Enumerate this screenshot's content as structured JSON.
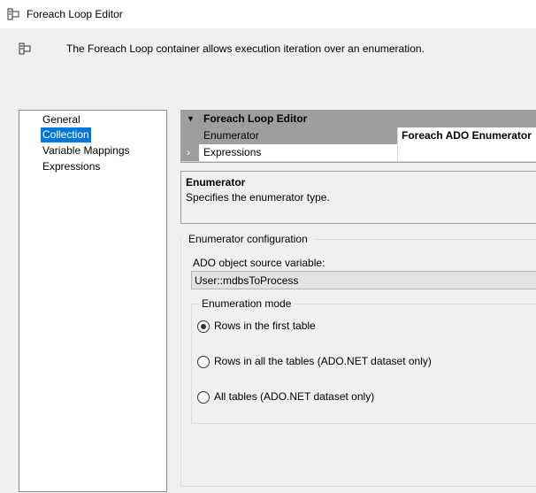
{
  "window": {
    "title": "Foreach Loop Editor",
    "icon": "foreach-container-icon"
  },
  "description": {
    "icon": "foreach-container-icon",
    "text": "The Foreach Loop container allows execution iteration over an enumeration."
  },
  "nav": {
    "items": [
      {
        "label": "General",
        "selected": false
      },
      {
        "label": "Collection",
        "selected": true
      },
      {
        "label": "Variable Mappings",
        "selected": false
      },
      {
        "label": "Expressions",
        "selected": false
      }
    ]
  },
  "property_grid": {
    "category": "Foreach Loop Editor",
    "rows": [
      {
        "name": "Enumerator",
        "value": "Foreach ADO Enumerator"
      },
      {
        "name": "Expressions",
        "value": ""
      }
    ]
  },
  "help": {
    "title": "Enumerator",
    "text": "Specifies the enumerator type."
  },
  "config": {
    "group_label": "Enumerator configuration",
    "ado_label": "ADO object source variable:",
    "ado_value": "User::mdbsToProcess",
    "mode_label": "Enumeration mode",
    "modes": [
      {
        "label": "Rows in the first table",
        "checked": true
      },
      {
        "label": "Rows in all the tables (ADO.NET dataset only)",
        "checked": false
      },
      {
        "label": "All tables (ADO.NET dataset only)",
        "checked": false
      }
    ]
  },
  "colors": {
    "selection": "#0078d7",
    "category_header": "#9e9e9e",
    "disabled_input": "#e3e3e3"
  }
}
